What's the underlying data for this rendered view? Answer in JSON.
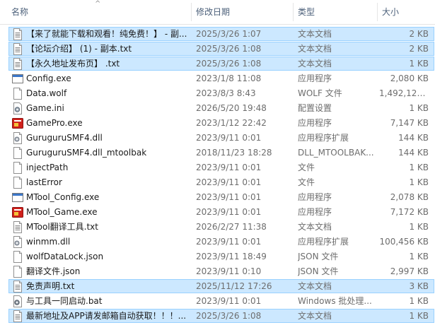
{
  "columns": {
    "name": "名称",
    "date": "修改日期",
    "type": "类型",
    "size": "大小"
  },
  "sort_arrow": "^",
  "files": [
    {
      "name": "【来了就能下载和观看！纯免费！】 - 副...",
      "date": "2025/3/26 1:07",
      "type": "文本文档",
      "size": "2 KB",
      "icon": "text-file-icon",
      "selected": true
    },
    {
      "name": "【论坛介绍】 (1) - 副本.txt",
      "date": "2025/3/26 1:08",
      "type": "文本文档",
      "size": "2 KB",
      "icon": "text-file-icon",
      "selected": true
    },
    {
      "name": "【永久地址发布页】 .txt",
      "date": "2025/3/26 1:08",
      "type": "文本文档",
      "size": "1 KB",
      "icon": "text-file-icon",
      "selected": true
    },
    {
      "name": "Config.exe",
      "date": "2023/1/8 11:08",
      "type": "应用程序",
      "size": "2,080 KB",
      "icon": "window-app-icon",
      "selected": false
    },
    {
      "name": "Data.wolf",
      "date": "2023/8/3 8:43",
      "type": "WOLF 文件",
      "size": "1,492,121...",
      "icon": "blank-file-icon",
      "selected": false
    },
    {
      "name": "Game.ini",
      "date": "2026/5/20 19:48",
      "type": "配置设置",
      "size": "1 KB",
      "icon": "settings-file-icon",
      "selected": false
    },
    {
      "name": "GamePro.exe",
      "date": "2023/1/12 22:42",
      "type": "应用程序",
      "size": "7,147 KB",
      "icon": "red-app-icon",
      "selected": false
    },
    {
      "name": "GuruguruSMF4.dll",
      "date": "2023/9/11 0:01",
      "type": "应用程序扩展",
      "size": "144 KB",
      "icon": "dll-file-icon",
      "selected": false
    },
    {
      "name": "GuruguruSMF4.dll_mtoolbak",
      "date": "2018/11/23 18:28",
      "type": "DLL_MTOOLBAK...",
      "size": "144 KB",
      "icon": "blank-file-icon",
      "selected": false
    },
    {
      "name": "injectPath",
      "date": "2023/9/11 0:01",
      "type": "文件",
      "size": "1 KB",
      "icon": "blank-file-icon",
      "selected": false
    },
    {
      "name": "lastError",
      "date": "2023/9/11 0:01",
      "type": "文件",
      "size": "1 KB",
      "icon": "blank-file-icon",
      "selected": false
    },
    {
      "name": "MTool_Config.exe",
      "date": "2023/9/11 0:01",
      "type": "应用程序",
      "size": "2,078 KB",
      "icon": "window-app-icon",
      "selected": false
    },
    {
      "name": "MTool_Game.exe",
      "date": "2023/9/11 0:01",
      "type": "应用程序",
      "size": "7,172 KB",
      "icon": "red-app-icon",
      "selected": false
    },
    {
      "name": "MTool翻译工具.txt",
      "date": "2026/2/27 11:38",
      "type": "文本文档",
      "size": "1 KB",
      "icon": "text-file-icon",
      "selected": false
    },
    {
      "name": "winmm.dll",
      "date": "2023/9/11 0:01",
      "type": "应用程序扩展",
      "size": "100,456 KB",
      "icon": "dll-file-icon",
      "selected": false
    },
    {
      "name": "wolfDataLock.json",
      "date": "2023/9/11 18:49",
      "type": "JSON 文件",
      "size": "1 KB",
      "icon": "blank-file-icon",
      "selected": false
    },
    {
      "name": "翻译文件.json",
      "date": "2023/9/11 0:10",
      "type": "JSON 文件",
      "size": "2,997 KB",
      "icon": "blank-file-icon",
      "selected": false
    },
    {
      "name": "免责声明.txt",
      "date": "2025/11/12 17:26",
      "type": "文本文档",
      "size": "3 KB",
      "icon": "text-file-icon",
      "selected": true
    },
    {
      "name": "与工具一同启动.bat",
      "date": "2023/9/11 0:01",
      "type": "Windows 批处理...",
      "size": "1 KB",
      "icon": "batch-file-icon",
      "selected": false
    },
    {
      "name": "最新地址及APP请发邮箱自动获取！！！...",
      "date": "2025/3/26 1:08",
      "type": "文本文档",
      "size": "1 KB",
      "icon": "text-file-icon",
      "selected": true
    }
  ],
  "colors": {
    "selection_fill": "#cce8ff",
    "selection_border": "#99d1ff",
    "header_text": "#4c607a",
    "detail_text": "#6d6d6d"
  }
}
